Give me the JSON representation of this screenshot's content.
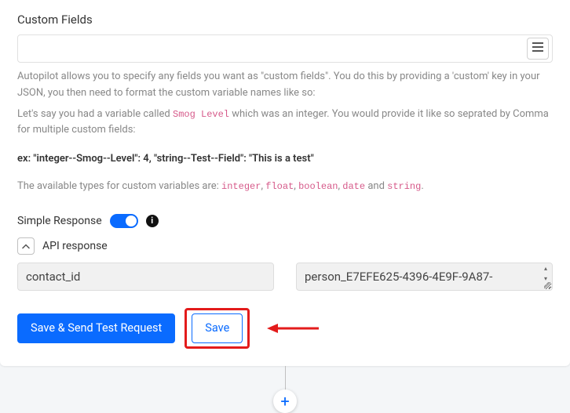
{
  "custom_fields": {
    "title": "Custom Fields",
    "input_value": "",
    "help1_a": "Autopilot allows you to specify any fields you want as \"custom fields\". You do this by providing a 'custom' key in your JSON, you then need to format the custom variable names like so:",
    "help2_a": "Let's say you had a variable called ",
    "help2_code": "Smog Level",
    "help2_b": " which was an integer. You would provide it like so seprated by Comma for multiple custom fields:",
    "ex_line": "ex: \"integer--Smog--Level\": 4, \"string--Test--Field\": \"This is a test\"",
    "types_a": "The available types for custom variables are: ",
    "types_integer": "integer",
    "types_float": "float",
    "types_boolean": "boolean",
    "types_date": "date",
    "types_and": " and ",
    "types_string": "string",
    "types_period": "."
  },
  "simple_response": {
    "label": "Simple Response",
    "enabled": true
  },
  "api_response": {
    "label": "API response",
    "key": "contact_id",
    "value": "person_E7EFE625-4396-4E9F-9A87-"
  },
  "buttons": {
    "save_send": "Save & Send Test Request",
    "save": "Save"
  }
}
